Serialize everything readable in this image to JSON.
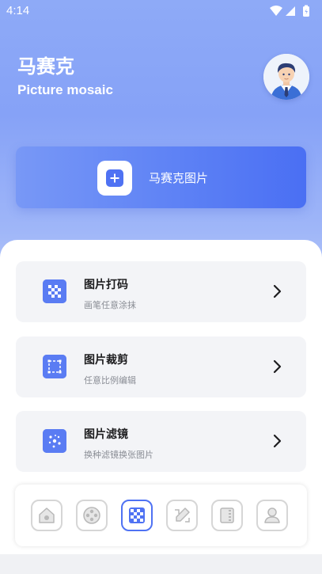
{
  "status_bar": {
    "time": "4:14"
  },
  "header": {
    "title": "马赛克",
    "subtitle": "Picture mosaic"
  },
  "hero": {
    "label": "马赛克图片"
  },
  "cards": [
    {
      "title": "图片打码",
      "subtitle": "画笔任意涂抹",
      "icon": "mosaic-checker-icon"
    },
    {
      "title": "图片裁剪",
      "subtitle": "任意比例编辑",
      "icon": "crop-icon"
    },
    {
      "title": "图片滤镜",
      "subtitle": "换种滤镜换张图片",
      "icon": "filter-icon"
    }
  ],
  "tabs": [
    {
      "icon": "home-icon",
      "active": false
    },
    {
      "icon": "film-reel-icon",
      "active": false
    },
    {
      "icon": "mosaic-icon",
      "active": true
    },
    {
      "icon": "pencil-icon",
      "active": false
    },
    {
      "icon": "film-strip-icon",
      "active": false
    },
    {
      "icon": "user-icon",
      "active": false
    }
  ],
  "colors": {
    "accent": "#4f72f3",
    "tab_border": "#d6d6d6",
    "card_bg": "#f3f4f7"
  }
}
